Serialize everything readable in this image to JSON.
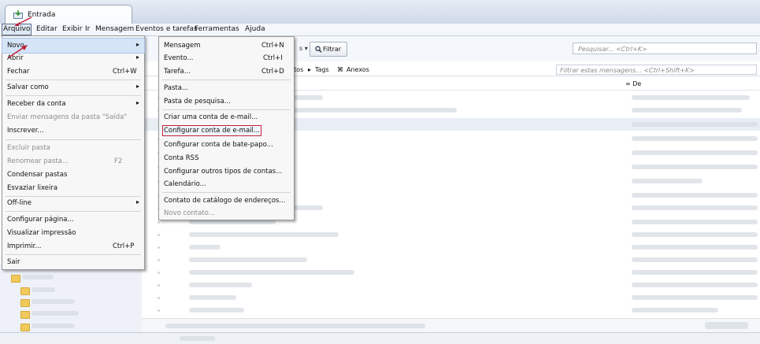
{
  "tab": {
    "title": "Entrada"
  },
  "menubar": {
    "items": [
      "Arquivo",
      "Editar",
      "Exibir",
      "Ir",
      "Mensagem",
      "Eventos e tarefas",
      "Ferramentas",
      "Ajuda"
    ]
  },
  "toolbar": {
    "filter_label": "Filtrar",
    "search_placeholder": "Pesquisar... <Ctrl+K>",
    "arrow_label": "s ▾"
  },
  "quickfilter": {
    "contatos": "tatos",
    "tags": "Tags",
    "anexos": "Anexos",
    "filter_placeholder": "Filtrar estas mensagens... <Ctrl+Shift+K>"
  },
  "columns": {
    "de": "De"
  },
  "file_menu": {
    "items": [
      {
        "label": "Novo",
        "shortcut": "",
        "submenu": true,
        "highlighted": true
      },
      {
        "label": "Abrir",
        "shortcut": "",
        "submenu": true
      },
      {
        "label": "Fechar",
        "shortcut": "Ctrl+W"
      },
      {
        "label": "Salvar como",
        "shortcut": "",
        "submenu": true
      },
      {
        "label": "Receber da conta",
        "shortcut": "",
        "submenu": true
      },
      {
        "label": "Enviar mensagens da pasta \"Saída\"",
        "shortcut": "",
        "disabled": true
      },
      {
        "label": "Inscrever...",
        "shortcut": ""
      },
      {
        "label": "Excluir pasta",
        "shortcut": "",
        "disabled": true
      },
      {
        "label": "Renomear pasta...",
        "shortcut": "F2",
        "disabled": true
      },
      {
        "label": "Condensar pastas",
        "shortcut": ""
      },
      {
        "label": "Esvaziar lixeira",
        "shortcut": ""
      },
      {
        "label": "Off-line",
        "shortcut": "",
        "submenu": true
      },
      {
        "label": "Configurar página...",
        "shortcut": ""
      },
      {
        "label": "Visualizar impressão",
        "shortcut": ""
      },
      {
        "label": "Imprimir...",
        "shortcut": "Ctrl+P"
      },
      {
        "label": "Sair",
        "shortcut": ""
      }
    ]
  },
  "new_submenu": {
    "items": [
      {
        "label": "Mensagem",
        "shortcut": "Ctrl+N"
      },
      {
        "label": "Evento...",
        "shortcut": "Ctrl+I"
      },
      {
        "label": "Tarefa...",
        "shortcut": "Ctrl+D"
      },
      {
        "label": "Pasta...",
        "shortcut": ""
      },
      {
        "label": "Pasta de pesquisa...",
        "shortcut": ""
      },
      {
        "label": "Criar uma conta de e-mail...",
        "shortcut": ""
      },
      {
        "label": "Configurar conta de e-mail...",
        "shortcut": "",
        "boxed": true
      },
      {
        "label": "Configurar conta de bate-papo...",
        "shortcut": ""
      },
      {
        "label": "Conta RSS",
        "shortcut": ""
      },
      {
        "label": "Configurar outros tipos de contas...",
        "shortcut": ""
      },
      {
        "label": "Calendário...",
        "shortcut": ""
      },
      {
        "label": "Contato de catálogo de endereços...",
        "shortcut": ""
      },
      {
        "label": "Novo contato...",
        "shortcut": "",
        "disabled": true
      }
    ]
  },
  "colors": {
    "highlight": "#d5e4f7",
    "callout": "#c0203a",
    "accent": "#2a6bd1"
  }
}
